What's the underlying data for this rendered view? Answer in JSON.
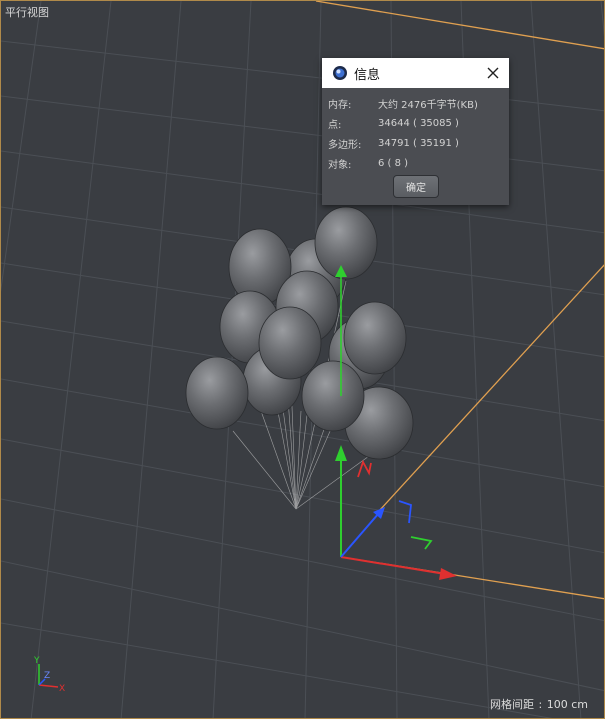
{
  "viewport": {
    "title": "平行视图",
    "grid_spacing_label": "网格间距",
    "grid_spacing_value": "100 cm"
  },
  "axis_indicator": {
    "x": "X",
    "y": "Y",
    "z": "Z"
  },
  "info_dialog": {
    "title": "信息",
    "rows": [
      {
        "label": "内存:",
        "value": "大约 2476千字节(KB)"
      },
      {
        "label": "点:",
        "value": "34644 ( 35085 )"
      },
      {
        "label": "多边形:",
        "value": "34791 ( 35191 )"
      },
      {
        "label": "对象:",
        "value": "6 ( 8 )"
      }
    ],
    "ok_label": "确定"
  },
  "colors": {
    "viewport_bg": "#3a3d42",
    "grid_line": "#4a4e54",
    "plane_edge": "#e0a050",
    "axis_x": "#e03030",
    "axis_y": "#2fcf2f",
    "axis_z": "#2a55ff",
    "balloon": "#6a6c70"
  },
  "scene": {
    "object_count": 14
  }
}
